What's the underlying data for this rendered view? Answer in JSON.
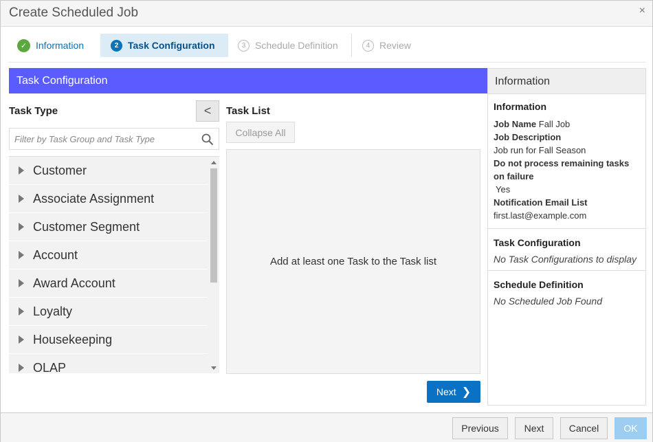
{
  "dialog": {
    "title": "Create Scheduled Job",
    "close": "×"
  },
  "train": {
    "steps": [
      {
        "num": "✓",
        "label": "Information"
      },
      {
        "num": "2",
        "label": "Task Configuration"
      },
      {
        "num": "3",
        "label": "Schedule Definition"
      },
      {
        "num": "4",
        "label": "Review"
      }
    ]
  },
  "task_config": {
    "header": "Task Configuration",
    "task_type_label": "Task Type",
    "collapse_toggle": "<",
    "filter_placeholder": "Filter by Task Group and Task Type",
    "task_types": [
      "Customer",
      "Associate Assignment",
      "Customer Segment",
      "Account",
      "Award Account",
      "Loyalty",
      "Housekeeping",
      "OLAP"
    ],
    "task_list_label": "Task List",
    "collapse_all": "Collapse All",
    "empty_message": "Add at least one Task to the Task list",
    "next_label": "Next",
    "next_chevron": "❯"
  },
  "info_panel": {
    "header": "Information",
    "information": {
      "title": "Information",
      "job_name_label": "Job Name",
      "job_name": "Fall Job",
      "job_description_label": "Job Description",
      "job_description": "Job run for Fall Season",
      "do_not_process_label": "Do not process remaining tasks on failure",
      "do_not_process_value": "Yes",
      "email_label": "Notification Email List",
      "email": "first.last@example.com"
    },
    "task_configuration": {
      "title": "Task Configuration",
      "empty": "No Task Configurations to display"
    },
    "schedule_definition": {
      "title": "Schedule Definition",
      "empty": "No Scheduled Job Found"
    }
  },
  "footer": {
    "previous": "Previous",
    "next": "Next",
    "cancel": "Cancel",
    "ok": "OK"
  },
  "colors": {
    "header_bar": "#5b5cff",
    "primary_button": "#0a72c4",
    "active_step_bg": "#dcecf7",
    "done_step": "#5aa83e"
  }
}
